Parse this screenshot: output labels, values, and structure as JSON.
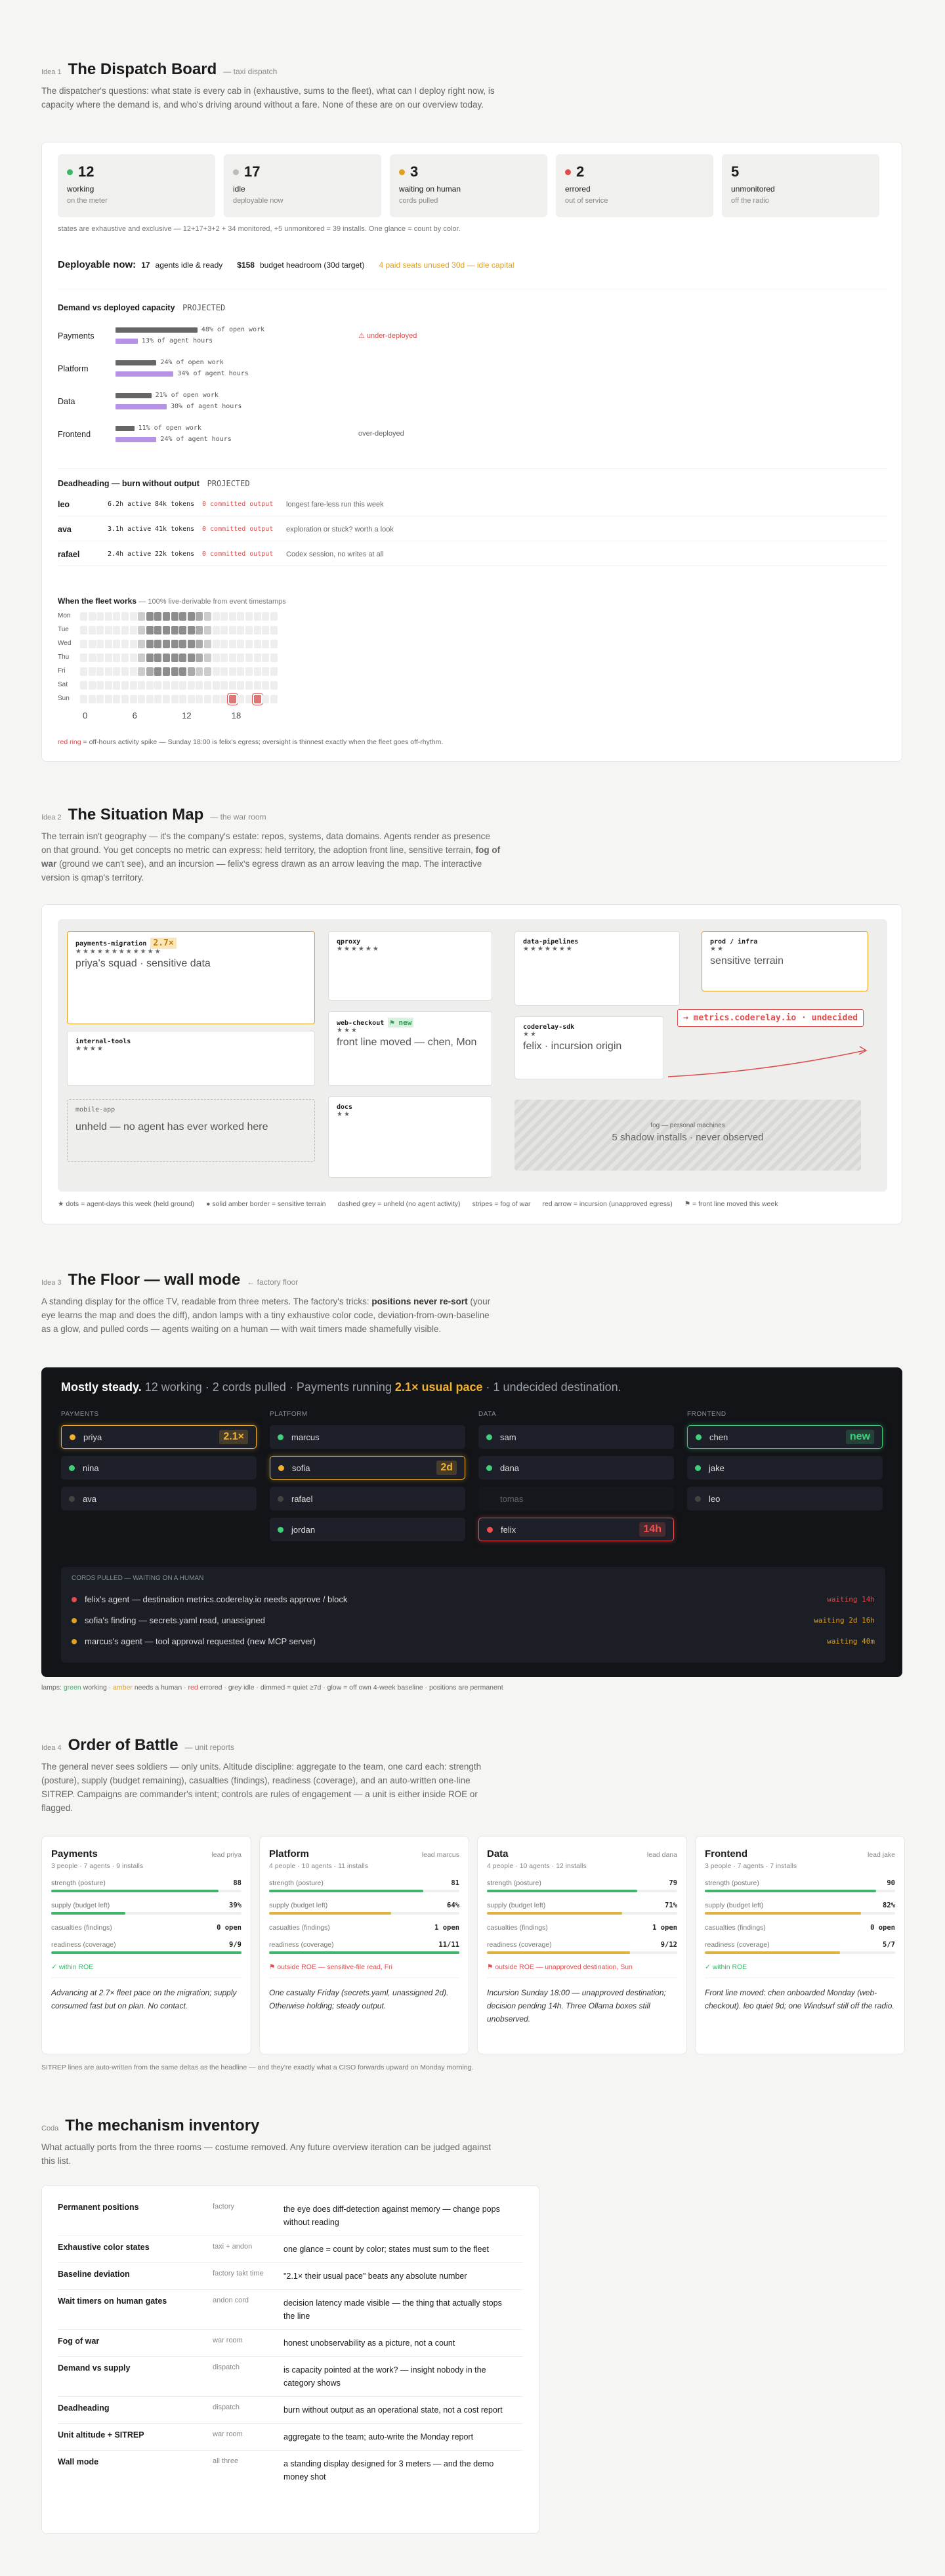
{
  "idea1": {
    "idea": "Idea 1",
    "title": "The Dispatch Board",
    "sub": "— taxi dispatch",
    "intro": "The dispatcher's questions: what state is every cab in (exhaustive, sums to the fleet), what can I deploy right now, is capacity where the demand is, and who's driving around without a fare. None of these are on our overview today.",
    "stats": [
      {
        "n": "12",
        "label": "working",
        "sub": "on the meter",
        "color": "#3fb46a"
      },
      {
        "n": "17",
        "label": "idle",
        "sub": "deployable now",
        "color": "#bbbbbb"
      },
      {
        "n": "3",
        "label": "waiting on human",
        "sub": "cords pulled",
        "color": "#e0a020"
      },
      {
        "n": "2",
        "label": "errored",
        "sub": "out of service",
        "color": "#e04c4c"
      },
      {
        "n": "5",
        "label": "unmonitored",
        "sub": "off the radio",
        "color": ""
      }
    ],
    "sum_note": "states are exhaustive and exclusive — 12+17+3+2 + 34 monitored, +5 unmonitored = 39 installs. One glance = count by color.",
    "deploy_label": "Deployable now:",
    "deploy_a": "17",
    "deploy_a_t": "agents idle & ready",
    "deploy_b": "$158",
    "deploy_b_t": "budget headroom (30d target)",
    "deploy_c": "4 paid seats unused 30d — idle capital",
    "dvd_title": "Demand vs deployed capacity",
    "dvd_tag": "PROJECTED",
    "dvd_rows": [
      {
        "name": "Payments",
        "open": "48% of open work",
        "hours": "13% of agent hours",
        "open_pct": 48,
        "hours_pct": 13,
        "note": "⚠ under-deployed",
        "note_red": true
      },
      {
        "name": "Platform",
        "open": "24% of open work",
        "hours": "34% of agent hours",
        "open_pct": 24,
        "hours_pct": 34,
        "note": "",
        "note_red": false
      },
      {
        "name": "Data",
        "open": "21% of open work",
        "hours": "30% of agent hours",
        "open_pct": 21,
        "hours_pct": 30,
        "note": "",
        "note_red": false
      },
      {
        "name": "Frontend",
        "open": "11% of open work",
        "hours": "24% of agent hours",
        "open_pct": 11,
        "hours_pct": 24,
        "note": "over-deployed",
        "note_red": false
      }
    ],
    "dh_title": "Deadheading — burn without output",
    "dh_tag": "PROJECTED",
    "dh_rows": [
      {
        "name": "leo",
        "active": "6.2h active",
        "tokens": "84k tokens",
        "out": "0 committed output",
        "note": "longest fare-less run this week"
      },
      {
        "name": "ava",
        "active": "3.1h active",
        "tokens": "41k tokens",
        "out": "0 committed output",
        "note": "exploration or stuck? worth a look"
      },
      {
        "name": "rafael",
        "active": "2.4h active",
        "tokens": "22k tokens",
        "out": "0 committed output",
        "note": "Codex session, no writes at all"
      }
    ],
    "hm_title": "When the fleet works",
    "hm_sub": "— 100% live-derivable from event timestamps",
    "days": [
      "Mon",
      "Tue",
      "Wed",
      "Thu",
      "Fri",
      "Sat",
      "Sun"
    ],
    "hours": [
      "0",
      "6",
      "12",
      "18"
    ],
    "hm_note_a": "red ring",
    "hm_note_b": "= off-hours activity spike — Sunday 18:00 is felix's egress; oversight is thinnest exactly when the fleet goes off-rhythm."
  },
  "idea2": {
    "idea": "Idea 2",
    "title": "The Situation Map",
    "sub": "— the war room",
    "intro_a": "The terrain isn't geography — it's the company's estate: repos, systems, data domains. Agents render as presence on that ground. You get concepts no metric can express: held territory, the adoption front line, sensitive terrain, ",
    "intro_b": "fog of war",
    "intro_c": " (ground we can't see), and an incursion — felix's egress drawn as an arrow leaving the map. The interactive version is qmap's territory.",
    "tiles": {
      "pm": {
        "name": "payments-migration",
        "x": "2.7×",
        "stars": "★★★★★★★★★★★★",
        "desc": "priya's squad · sensitive data"
      },
      "qp": {
        "name": "qproxy",
        "stars": "★★★★★★"
      },
      "dp": {
        "name": "data-pipelines",
        "stars": "★★★★★★★"
      },
      "pi": {
        "name": "prod / infra",
        "stars": "★★",
        "desc": "sensitive terrain"
      },
      "it": {
        "name": "internal-tools",
        "stars": "★★★★"
      },
      "wc": {
        "name": "web-checkout",
        "flag": "⚑ new",
        "stars": "★★★",
        "desc": "front line moved — chen, Mon"
      },
      "cs": {
        "name": "coderelay-sdk",
        "stars": "★★",
        "desc": "felix · incursion origin"
      },
      "ma": {
        "name": "mobile-app",
        "desc": "unheld — no agent has ever worked here"
      },
      "dc": {
        "name": "docs",
        "stars": "★★"
      },
      "fog_t": "fog — personal machines",
      "fog_d": "5 shadow installs · never observed",
      "alert": "→ metrics.coderelay.io · undecided"
    },
    "legend": [
      "★ dots = agent-days this week (held ground)",
      "● solid amber border = sensitive terrain",
      "dashed grey = unheld (no agent activity)",
      "stripes = fog of war",
      "red arrow = incursion (unapproved egress)",
      "⚑ = front line moved this week"
    ]
  },
  "idea3": {
    "idea": "Idea 3",
    "title": "The Floor — wall mode",
    "sub": "← factory floor",
    "intro_a": "A standing display for the office TV, readable from three meters. The factory's tricks: ",
    "intro_b": "positions never re-sort",
    "intro_c": " (your eye learns the map and does the diff), andon lamps with a tiny exhaustive color code, deviation-from-own-baseline as a glow, and pulled cords — agents waiting on a human — with wait timers made shamefully visible.",
    "headline_a": "Mostly steady.",
    "headline_b": " 12 working · 2 cords pulled · Payments running ",
    "headline_c": "2.1× usual pace",
    "headline_d": " · 1 undecided destination.",
    "cols": [
      {
        "head": "PAYMENTS",
        "cards": [
          {
            "name": "priya",
            "state": "amber",
            "badge": "2.1×",
            "hl": true
          },
          {
            "name": "nina",
            "state": "green"
          },
          {
            "name": "ava",
            "state": "grey"
          }
        ]
      },
      {
        "head": "PLATFORM",
        "cards": [
          {
            "name": "marcus",
            "state": "green"
          },
          {
            "name": "sofia",
            "state": "amber",
            "badge": "2d",
            "hl": true
          },
          {
            "name": "rafael",
            "state": "grey"
          },
          {
            "name": "jordan",
            "state": "green"
          }
        ]
      },
      {
        "head": "DATA",
        "cards": [
          {
            "name": "sam",
            "state": "green"
          },
          {
            "name": "dana",
            "state": "green"
          },
          {
            "name": "tomas",
            "state": "dim"
          },
          {
            "name": "felix",
            "state": "red",
            "badge": "14h",
            "hl": true
          }
        ]
      },
      {
        "head": "FRONTEND",
        "cards": [
          {
            "name": "chen",
            "state": "green",
            "badge": "new",
            "hl": true
          },
          {
            "name": "jake",
            "state": "green"
          },
          {
            "name": "leo",
            "state": "grey"
          }
        ]
      }
    ],
    "cords_title": "CORDS PULLED — WAITING ON A HUMAN",
    "cords": [
      {
        "text": "felix's agent — destination metrics.coderelay.io needs approve / block",
        "wait": "waiting 14h",
        "color": "#e04c4c"
      },
      {
        "text": "sofia's finding — secrets.yaml read, unassigned",
        "wait": "waiting 2d 16h",
        "color": "#e0a020"
      },
      {
        "text": "marcus's agent — tool approval requested (new MCP server)",
        "wait": "waiting 40m",
        "color": "#e0a020"
      }
    ],
    "legend_a": "lamps: ",
    "legend_g": "green",
    "legend_b": " working · ",
    "legend_am": "amber",
    "legend_c": " needs a human · ",
    "legend_r": "red",
    "legend_d": " errored · grey idle · dimmed = quiet ≥7d · glow = off own 4-week baseline · positions are permanent"
  },
  "idea4": {
    "idea": "Idea 4",
    "title": "Order of Battle",
    "sub": "— unit reports",
    "intro": "The general never sees soldiers — only units. Altitude discipline: aggregate to the team, one card each: strength (posture), supply (budget remaining), casualties (findings), readiness (coverage), and an auto-written one-line SITREP. Campaigns are commander's intent; controls are rules of engagement — a unit is either inside ROE or flagged.",
    "units": [
      {
        "name": "Payments",
        "lead": "lead priya",
        "meta": "3 people · 7 agents · 9 installs",
        "strength": "88",
        "strength_pct": 88,
        "supply": "39%",
        "supply_pct": 39,
        "cas": "0 open",
        "ready": "9/9",
        "ready_pct": 100,
        "roe": "✓ within ROE",
        "roe_ok": true,
        "sitrep": "Advancing at 2.7× fleet pace on the migration; supply consumed fast but on plan. No contact."
      },
      {
        "name": "Platform",
        "lead": "lead marcus",
        "meta": "4 people · 10 agents · 11 installs",
        "strength": "81",
        "strength_pct": 81,
        "supply": "64%",
        "supply_pct": 64,
        "cas": "1 open",
        "ready": "11/11",
        "ready_pct": 100,
        "roe": "⚑ outside ROE — sensitive-file read, Fri",
        "roe_ok": false,
        "sitrep": "One casualty Friday (secrets.yaml, unassigned 2d). Otherwise holding; steady output."
      },
      {
        "name": "Data",
        "lead": "lead dana",
        "meta": "4 people · 10 agents · 12 installs",
        "strength": "79",
        "strength_pct": 79,
        "supply": "71%",
        "supply_pct": 71,
        "cas": "1 open",
        "ready": "9/12",
        "ready_pct": 75,
        "roe": "⚑ outside ROE — unapproved destination, Sun",
        "roe_ok": false,
        "sitrep": "Incursion Sunday 18:00 — unapproved destination; decision pending 14h. Three Ollama boxes still unobserved."
      },
      {
        "name": "Frontend",
        "lead": "lead jake",
        "meta": "3 people · 7 agents · 7 installs",
        "strength": "90",
        "strength_pct": 90,
        "supply": "82%",
        "supply_pct": 82,
        "cas": "0 open",
        "ready": "5/7",
        "ready_pct": 71,
        "roe": "✓ within ROE",
        "roe_ok": true,
        "sitrep": "Front line moved: chen onboarded Monday (web-checkout). leo quiet 9d; one Windsurf still off the radio."
      }
    ],
    "labels": {
      "strength": "strength (posture)",
      "supply": "supply (budget left)",
      "cas": "casualties (findings)",
      "ready": "readiness (coverage)"
    },
    "footnote": "SITREP lines are auto-written from the same deltas as the headline — and they're exactly what a CISO forwards upward on Monday morning."
  },
  "coda": {
    "idea": "Coda",
    "title": "The mechanism inventory",
    "intro": "What actually ports from the three rooms — costume removed. Any future overview iteration can be judged against this list.",
    "rows": [
      {
        "a": "Permanent positions",
        "b": "factory",
        "c": "the eye does diff-detection against memory — change pops without reading"
      },
      {
        "a": "Exhaustive color states",
        "b": "taxi + andon",
        "c": "one glance = count by color; states must sum to the fleet"
      },
      {
        "a": "Baseline deviation",
        "b": "factory takt time",
        "c": "\"2.1× their usual pace\" beats any absolute number"
      },
      {
        "a": "Wait timers on human gates",
        "b": "andon cord",
        "c": "decision latency made visible — the thing that actually stops the line"
      },
      {
        "a": "Fog of war",
        "b": "war room",
        "c": "honest unobservability as a picture, not a count"
      },
      {
        "a": "Demand vs supply",
        "b": "dispatch",
        "c": "is capacity pointed at the work? — insight nobody in the category shows"
      },
      {
        "a": "Deadheading",
        "b": "dispatch",
        "c": "burn without output as an operational state, not a cost report"
      },
      {
        "a": "Unit altitude + SITREP",
        "b": "war room",
        "c": "aggregate to the team; auto-write the Monday report"
      },
      {
        "a": "Wall mode",
        "b": "all three",
        "c": "a standing display designed for 3 meters — and the demo money shot"
      }
    ]
  }
}
